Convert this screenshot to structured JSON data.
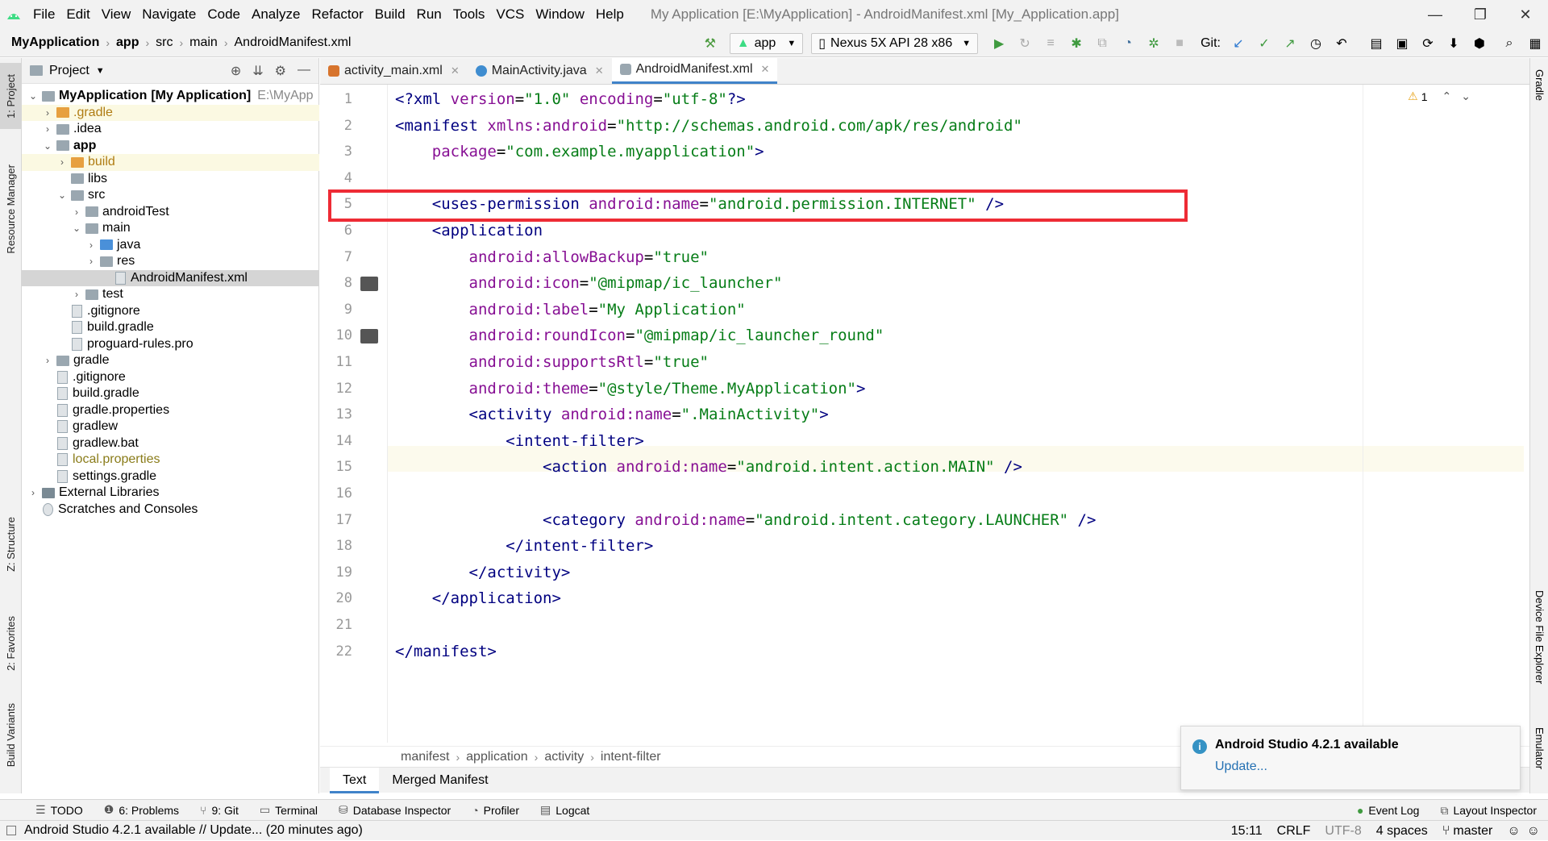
{
  "menubar": {
    "items": [
      "File",
      "Edit",
      "View",
      "Navigate",
      "Code",
      "Analyze",
      "Refactor",
      "Build",
      "Run",
      "Tools",
      "VCS",
      "Window",
      "Help"
    ],
    "window_title": "My Application [E:\\MyApplication] - AndroidManifest.xml [My_Application.app]"
  },
  "navbar": {
    "crumbs": [
      "MyApplication",
      "app",
      "src",
      "main",
      "AndroidManifest.xml"
    ],
    "run_config": "app",
    "device": "Nexus 5X API 28 x86",
    "git_label": "Git:"
  },
  "left_strip": {
    "tabs": [
      "1: Project",
      "Resource Manager",
      "Z: Structure",
      "2: Favorites",
      "Build Variants"
    ]
  },
  "project": {
    "header": "Project",
    "rows": [
      {
        "label": "MyApplication",
        "suffix": "[My Application]",
        "path": "E:\\MyApp",
        "indent": 0,
        "arrow": "v",
        "icon": "folder",
        "bold": true
      },
      {
        "label": ".gradle",
        "indent": 1,
        "arrow": ">",
        "icon": "folder-orange",
        "color": "#b07d14"
      },
      {
        "label": ".idea",
        "indent": 1,
        "arrow": ">",
        "icon": "folder"
      },
      {
        "label": "app",
        "indent": 1,
        "arrow": "v",
        "icon": "folder",
        "bold": true
      },
      {
        "label": "build",
        "indent": 2,
        "arrow": ">",
        "icon": "folder-orange",
        "color": "#b07d14"
      },
      {
        "label": "libs",
        "indent": 2,
        "arrow": "",
        "icon": "folder"
      },
      {
        "label": "src",
        "indent": 2,
        "arrow": "v",
        "icon": "folder"
      },
      {
        "label": "androidTest",
        "indent": 3,
        "arrow": ">",
        "icon": "folder"
      },
      {
        "label": "main",
        "indent": 3,
        "arrow": "v",
        "icon": "folder"
      },
      {
        "label": "java",
        "indent": 4,
        "arrow": ">",
        "icon": "folder-blue"
      },
      {
        "label": "res",
        "indent": 4,
        "arrow": ">",
        "icon": "folder"
      },
      {
        "label": "AndroidManifest.xml",
        "indent": 5,
        "arrow": "",
        "icon": "file"
      },
      {
        "label": "test",
        "indent": 3,
        "arrow": ">",
        "icon": "folder"
      },
      {
        "label": ".gitignore",
        "indent": 2,
        "arrow": "",
        "icon": "file"
      },
      {
        "label": "build.gradle",
        "indent": 2,
        "arrow": "",
        "icon": "file"
      },
      {
        "label": "proguard-rules.pro",
        "indent": 2,
        "arrow": "",
        "icon": "file"
      },
      {
        "label": "gradle",
        "indent": 1,
        "arrow": ">",
        "icon": "folder"
      },
      {
        "label": ".gitignore",
        "indent": 1,
        "arrow": "",
        "icon": "file"
      },
      {
        "label": "build.gradle",
        "indent": 1,
        "arrow": "",
        "icon": "file"
      },
      {
        "label": "gradle.properties",
        "indent": 1,
        "arrow": "",
        "icon": "file"
      },
      {
        "label": "gradlew",
        "indent": 1,
        "arrow": "",
        "icon": "file"
      },
      {
        "label": "gradlew.bat",
        "indent": 1,
        "arrow": "",
        "icon": "file"
      },
      {
        "label": "local.properties",
        "indent": 1,
        "arrow": "",
        "icon": "file",
        "color": "#8a7c1a"
      },
      {
        "label": "settings.gradle",
        "indent": 1,
        "arrow": "",
        "icon": "file"
      },
      {
        "label": "External Libraries",
        "indent": 0,
        "arrow": ">",
        "icon": "libs"
      },
      {
        "label": "Scratches and Consoles",
        "indent": 0,
        "arrow": "",
        "icon": "scratch"
      }
    ]
  },
  "editor": {
    "tabs": [
      {
        "label": "activity_main.xml",
        "active": false
      },
      {
        "label": "MainActivity.java",
        "active": false
      },
      {
        "label": "AndroidManifest.xml",
        "active": true
      }
    ],
    "warning_count": "1",
    "lines": [
      "1",
      "2",
      "3",
      "4",
      "5",
      "6",
      "7",
      "8",
      "9",
      "10",
      "11",
      "12",
      "13",
      "14",
      "15",
      "16",
      "17",
      "18",
      "19",
      "20",
      "21",
      "22"
    ],
    "code": [
      [
        {
          "t": "<?xml ",
          "c": "tag"
        },
        {
          "t": "version",
          "c": "attr"
        },
        {
          "t": "=",
          "c": "plain"
        },
        {
          "t": "\"1.0\"",
          "c": "val"
        },
        {
          "t": " encoding",
          "c": "attr"
        },
        {
          "t": "=",
          "c": "plain"
        },
        {
          "t": "\"utf-8\"",
          "c": "val"
        },
        {
          "t": "?>",
          "c": "tag"
        }
      ],
      [
        {
          "t": "<manifest ",
          "c": "tag"
        },
        {
          "t": "xmlns:android",
          "c": "attr"
        },
        {
          "t": "=",
          "c": "plain"
        },
        {
          "t": "\"http://schemas.android.com/apk/res/android\"",
          "c": "val"
        }
      ],
      [
        {
          "t": "    package",
          "c": "attr"
        },
        {
          "t": "=",
          "c": "plain"
        },
        {
          "t": "\"com.example.myapplication\"",
          "c": "val"
        },
        {
          "t": ">",
          "c": "tag"
        }
      ],
      [],
      [
        {
          "t": "    <uses-permission ",
          "c": "tag"
        },
        {
          "t": "android:name",
          "c": "attr"
        },
        {
          "t": "=",
          "c": "plain"
        },
        {
          "t": "\"android.permission.INTERNET\"",
          "c": "val"
        },
        {
          "t": " />",
          "c": "tag"
        }
      ],
      [
        {
          "t": "    <application",
          "c": "tag"
        }
      ],
      [
        {
          "t": "        android:allowBackup",
          "c": "attr"
        },
        {
          "t": "=",
          "c": "plain"
        },
        {
          "t": "\"true\"",
          "c": "val"
        }
      ],
      [
        {
          "t": "        android:icon",
          "c": "attr"
        },
        {
          "t": "=",
          "c": "plain"
        },
        {
          "t": "\"@mipmap/ic_launcher\"",
          "c": "val"
        }
      ],
      [
        {
          "t": "        android:label",
          "c": "attr"
        },
        {
          "t": "=",
          "c": "plain"
        },
        {
          "t": "\"My Application\"",
          "c": "val"
        }
      ],
      [
        {
          "t": "        android:roundIcon",
          "c": "attr"
        },
        {
          "t": "=",
          "c": "plain"
        },
        {
          "t": "\"@mipmap/ic_launcher_round\"",
          "c": "val"
        }
      ],
      [
        {
          "t": "        android:supportsRtl",
          "c": "attr"
        },
        {
          "t": "=",
          "c": "plain"
        },
        {
          "t": "\"true\"",
          "c": "val"
        }
      ],
      [
        {
          "t": "        android:theme",
          "c": "attr"
        },
        {
          "t": "=",
          "c": "plain"
        },
        {
          "t": "\"@style/Theme.MyApplication\"",
          "c": "val"
        },
        {
          "t": ">",
          "c": "tag"
        }
      ],
      [
        {
          "t": "        <activity ",
          "c": "tag"
        },
        {
          "t": "android:name",
          "c": "attr"
        },
        {
          "t": "=",
          "c": "plain"
        },
        {
          "t": "\".MainActivity\"",
          "c": "val"
        },
        {
          "t": ">",
          "c": "tag"
        }
      ],
      [
        {
          "t": "            <intent-filter>",
          "c": "tag"
        }
      ],
      [
        {
          "t": "                <action ",
          "c": "tag"
        },
        {
          "t": "android:name",
          "c": "attr"
        },
        {
          "t": "=",
          "c": "plain"
        },
        {
          "t": "\"android.intent.action.MAIN\"",
          "c": "val"
        },
        {
          "t": " />",
          "c": "tag"
        }
      ],
      [],
      [
        {
          "t": "                <category ",
          "c": "tag"
        },
        {
          "t": "android:name",
          "c": "attr"
        },
        {
          "t": "=",
          "c": "plain"
        },
        {
          "t": "\"android.intent.category.LAUNCHER\"",
          "c": "val"
        },
        {
          "t": " />",
          "c": "tag"
        }
      ],
      [
        {
          "t": "            </intent-filter>",
          "c": "tag"
        }
      ],
      [
        {
          "t": "        </activity>",
          "c": "tag"
        }
      ],
      [
        {
          "t": "    </application>",
          "c": "tag"
        }
      ],
      [],
      [
        {
          "t": "</manifest>",
          "c": "tag"
        }
      ]
    ],
    "breadcrumbs": [
      "manifest",
      "application",
      "activity",
      "intent-filter"
    ],
    "bottom_tabs": [
      "Text",
      "Merged Manifest"
    ]
  },
  "right_strip": {
    "tabs": [
      "Gradle",
      "Device File Explorer",
      "Emulator"
    ]
  },
  "notification": {
    "title": "Android Studio 4.2.1 available",
    "link": "Update..."
  },
  "bottom_tools": {
    "left": [
      "TODO",
      "6: Problems",
      "9: Git",
      "Terminal",
      "Database Inspector",
      "Profiler",
      "Logcat"
    ],
    "right": [
      "Event Log",
      "Layout Inspector"
    ]
  },
  "status": {
    "message": "Android Studio 4.2.1 available // Update... (20 minutes ago)",
    "position": "15:11",
    "line_sep": "CRLF",
    "encoding": "UTF-8",
    "indent": "4 spaces",
    "branch": "master"
  },
  "colors": {
    "highlight_box": "#ee2b35",
    "accent": "#4083c9",
    "tag": "#000080",
    "attr": "#871094",
    "value": "#067d17"
  }
}
